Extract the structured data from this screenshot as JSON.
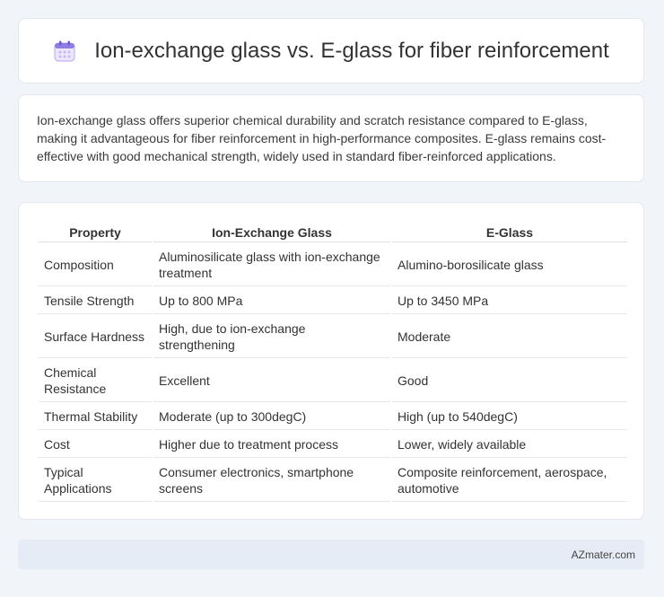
{
  "header": {
    "title": "Ion-exchange glass vs. E-glass for fiber reinforcement",
    "icon": "calendar-icon"
  },
  "intro": {
    "text": "Ion-exchange glass offers superior chemical durability and scratch resistance compared to E-glass, making it advantageous for fiber reinforcement in high-performance composites. E-glass remains cost-effective with good mechanical strength, widely used in standard fiber-reinforced applications."
  },
  "table": {
    "headers": [
      "Property",
      "Ion-Exchange Glass",
      "E-Glass"
    ],
    "rows": [
      [
        "Composition",
        "Aluminosilicate glass with ion-exchange treatment",
        "Alumino-borosilicate glass"
      ],
      [
        "Tensile Strength",
        "Up to 800 MPa",
        "Up to 3450 MPa"
      ],
      [
        "Surface Hardness",
        "High, due to ion-exchange strengthening",
        "Moderate"
      ],
      [
        "Chemical Resistance",
        "Excellent",
        "Good"
      ],
      [
        "Thermal Stability",
        "Moderate (up to 300degC)",
        "High (up to 540degC)"
      ],
      [
        "Cost",
        "Higher due to treatment process",
        "Lower, widely available"
      ],
      [
        "Typical Applications",
        "Consumer electronics, smartphone screens",
        "Composite reinforcement, aerospace, automotive"
      ]
    ]
  },
  "footer": {
    "text": "AZmater.com"
  }
}
